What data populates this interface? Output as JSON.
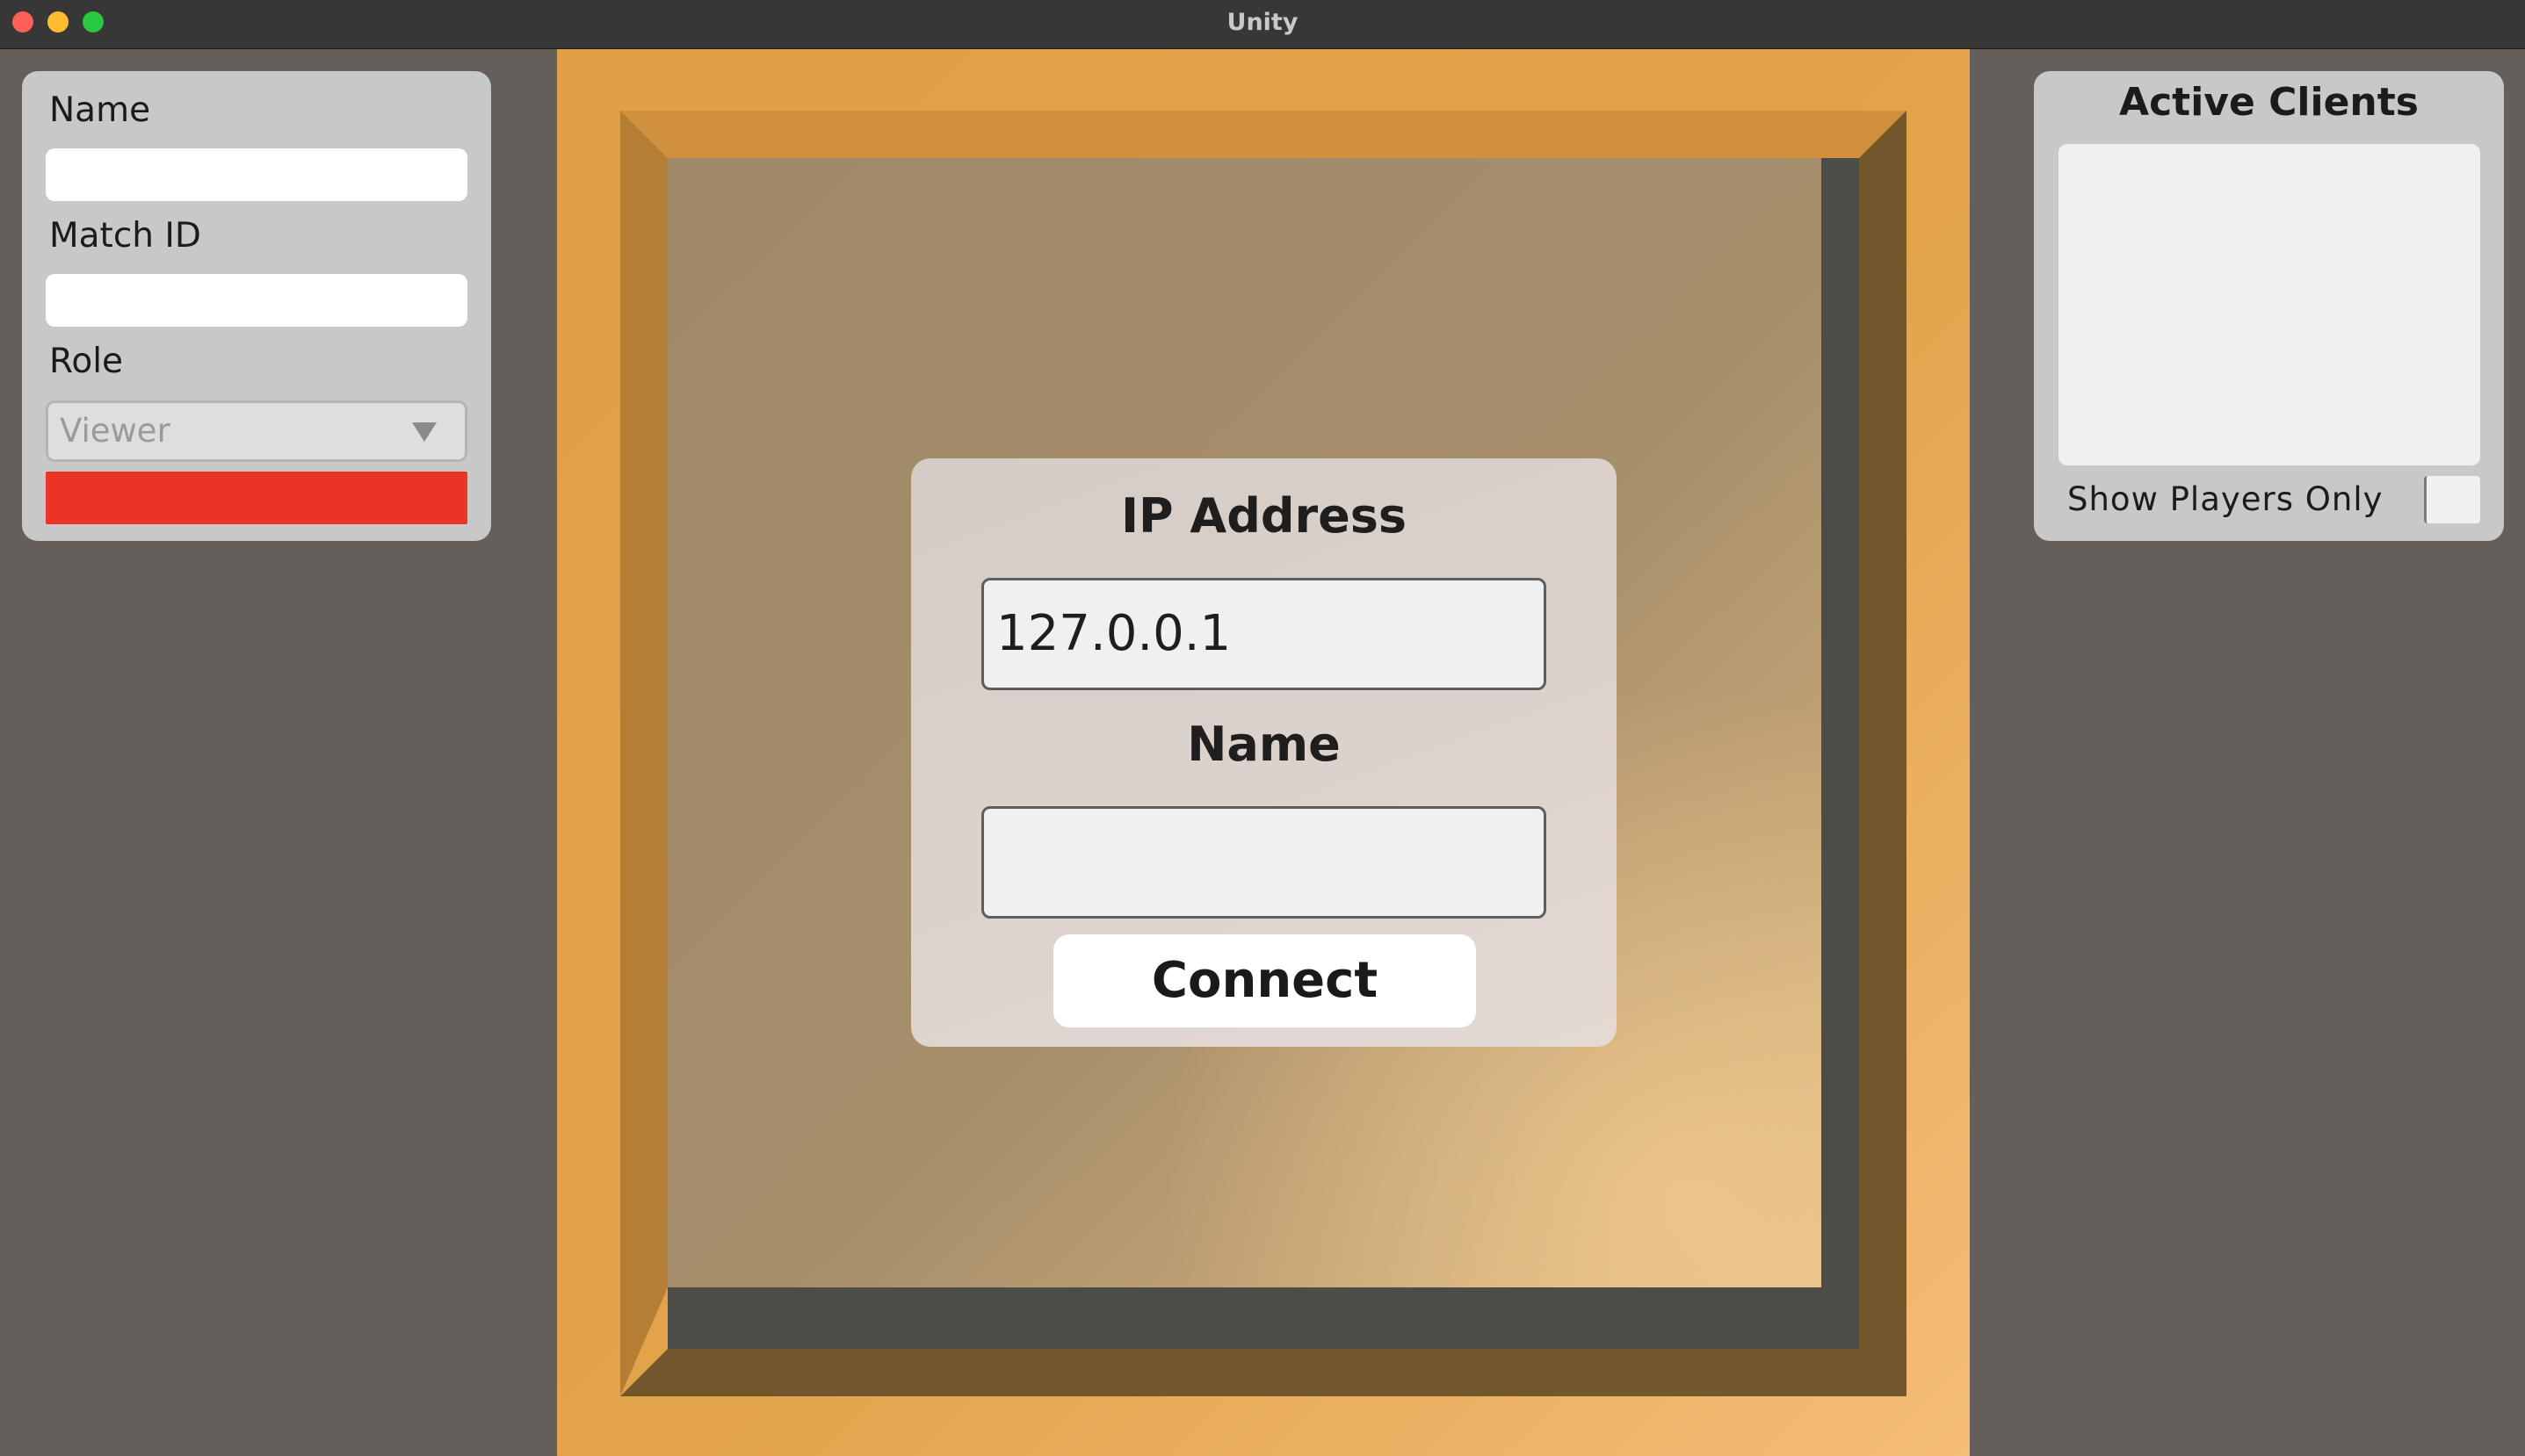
{
  "window": {
    "title": "Unity"
  },
  "left_panel": {
    "name_label": "Name",
    "name_value": "",
    "match_id_label": "Match ID",
    "match_id_value": "",
    "role_label": "Role",
    "role_selected": "Viewer"
  },
  "dialog": {
    "ip_label": "IP Address",
    "ip_value": "127.0.0.1",
    "name_label": "Name",
    "name_value": "",
    "connect_label": "Connect"
  },
  "right_panel": {
    "title": "Active Clients",
    "clients": [],
    "show_players_only_label": "Show Players Only",
    "show_players_only_checked": false
  },
  "colors": {
    "window_background": "#645f5a",
    "panel_background": "#c8c8c8",
    "viewport_orange": "#e2a34b",
    "status_bar_red": "#ec3426",
    "dialog_background": "#dcd2cc"
  },
  "icons": {
    "window_controls": [
      "close-dot-icon",
      "minimize-dot-icon",
      "maximize-dot-icon"
    ],
    "role_dropdown": "triangle-down-icon"
  }
}
